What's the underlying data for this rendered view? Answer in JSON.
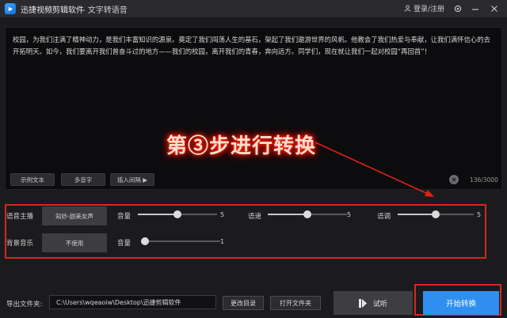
{
  "titlebar": {
    "app_name": "迅捷视频剪辑软件",
    "subtitle": "- 文字转语音",
    "login_label": "登录/注册"
  },
  "editor": {
    "text": "校园，为我们注满了精神动力，是我们丰富知识的源泉。奠定了我们闯荡人生的基石，架起了我们遨游世界的风帆。他教会了我们热爱与奉献，让我们满怀信心的去开拓明天。如今，我们要离开我们曾奋斗过的地方——我们的校园，离开我们的青春，奔向远方。同学们，现在就让我们一起对校园“再回首”！",
    "buttons": {
      "sample_text": "示例文本",
      "polyphone": "多音字",
      "insert_pause": "插入间隔 ▶"
    },
    "char_count": "136/3000"
  },
  "annotation": {
    "step_text": "第③步进行转换"
  },
  "settings": {
    "voice": {
      "label": "语音主播",
      "value": "知妙-甜美女声"
    },
    "volume": {
      "label": "音量",
      "value": "5",
      "level": 0.5
    },
    "speed": {
      "label": "语速",
      "value": "5",
      "level": 0.5
    },
    "pitch": {
      "label": "语调",
      "value": "5",
      "level": 0.5
    },
    "bgm": {
      "label": "背景音乐",
      "value": "不使用"
    },
    "bgm_volume": {
      "label": "音量",
      "value": "1",
      "level": 0.0
    }
  },
  "bottom": {
    "output_label": "导出文件夹:",
    "output_path": "C:\\Users\\wqeaoiw\\Desktop\\迅捷剪辑软件",
    "change_dir": "更改目录",
    "open_folder": "打开文件夹",
    "listen": "试听",
    "start": "开始转换"
  },
  "colors": {
    "accent": "#2f8ff0",
    "highlight_red": "#d8261f",
    "background": "#1b1b1e"
  }
}
